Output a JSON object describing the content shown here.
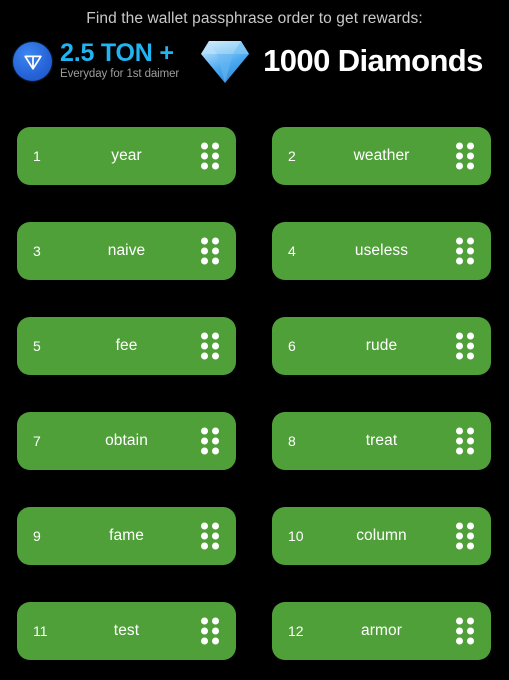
{
  "header": {
    "title": "Find the wallet passphrase order to get rewards:",
    "ton_reward": {
      "icon": "ton-logo-icon",
      "amount": "2.5 TON +",
      "subtitle": "Everyday for 1st daimer",
      "accent_color": "#21b4f2",
      "logo_color": "#2563d8"
    },
    "diamond_reward": {
      "icon": "diamond-icon",
      "amount": "1000 Diamonds",
      "color": "#ffffff",
      "gem_color": "#4aa8f0"
    }
  },
  "theme": {
    "background": "#000000",
    "card_green": "#50a03a",
    "card_text": "#ffffff",
    "title_color": "#c9c9c9"
  },
  "passphrase": {
    "handle_icon": "drag-handle-dots-icon",
    "words": [
      {
        "index": "1",
        "word": "year"
      },
      {
        "index": "2",
        "word": "weather"
      },
      {
        "index": "3",
        "word": "naive"
      },
      {
        "index": "4",
        "word": "useless"
      },
      {
        "index": "5",
        "word": "fee"
      },
      {
        "index": "6",
        "word": "rude"
      },
      {
        "index": "7",
        "word": "obtain"
      },
      {
        "index": "8",
        "word": "treat"
      },
      {
        "index": "9",
        "word": "fame"
      },
      {
        "index": "10",
        "word": "column"
      },
      {
        "index": "11",
        "word": "test"
      },
      {
        "index": "12",
        "word": "armor"
      }
    ]
  }
}
